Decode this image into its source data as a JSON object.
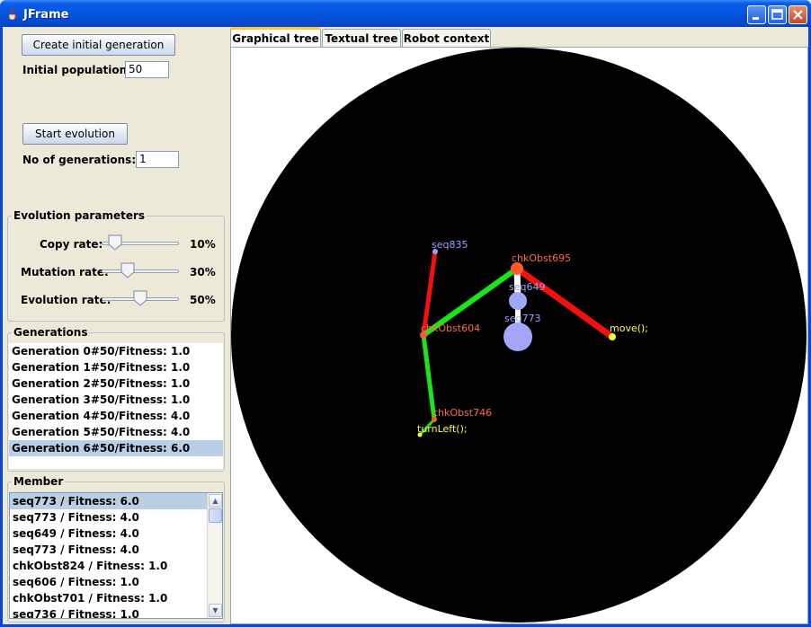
{
  "window": {
    "title": "JFrame"
  },
  "controls": {
    "create_button": "Create initial generation",
    "initial_population_label": "Initial population:",
    "initial_population_value": "50",
    "start_button": "Start evolution",
    "generations_label": "No of generations:",
    "generations_value": "1"
  },
  "evolution_parameters": {
    "title": "Evolution parameters",
    "sliders": [
      {
        "label": "Copy rate:",
        "value_text": "10%",
        "value": 10
      },
      {
        "label": "Mutation rate:",
        "value_text": "30%",
        "value": 30
      },
      {
        "label": "Evolution rate:",
        "value_text": "50%",
        "value": 50
      }
    ]
  },
  "generations": {
    "title": "Generations",
    "selected_index": 6,
    "items": [
      "Generation 0#50/Fitness: 1.0",
      "Generation 1#50/Fitness: 1.0",
      "Generation 2#50/Fitness: 1.0",
      "Generation 3#50/Fitness: 1.0",
      "Generation 4#50/Fitness: 4.0",
      "Generation 5#50/Fitness: 4.0",
      "Generation 6#50/Fitness: 6.0"
    ]
  },
  "member": {
    "title": "Member",
    "selected_index": 0,
    "items": [
      "seq773 / Fitness: 6.0",
      "seq773 / Fitness: 4.0",
      "seq649 / Fitness: 4.0",
      "seq773 / Fitness: 4.0",
      "chkObst824 / Fitness: 1.0",
      "seq606 / Fitness: 1.0",
      "chkObst701 / Fitness: 1.0",
      "seq736 / Fitness: 1.0"
    ]
  },
  "tabs": [
    "Graphical tree",
    "Textual tree",
    "Robot context"
  ],
  "tree": {
    "nodes": [
      {
        "label": "seq835",
        "color": "#9aa0ff"
      },
      {
        "label": "chkObst695",
        "color": "#ff6a3a"
      },
      {
        "label": "seq649",
        "color": "#9aa0ff"
      },
      {
        "label": "seq773",
        "color": "#9aa0ff"
      },
      {
        "label": "chkObst604",
        "color": "#ff6a3a"
      },
      {
        "label": "move();",
        "color": "#ffff33"
      },
      {
        "label": "chkObst746",
        "color": "#ff6a3a"
      },
      {
        "label": "turnLeft();",
        "color": "#ffff33"
      }
    ]
  },
  "colors": {
    "edge_green": "#19e619",
    "edge_red": "#f51010",
    "edge_white": "#ffffff",
    "node_blue": "#a3a6f8"
  }
}
